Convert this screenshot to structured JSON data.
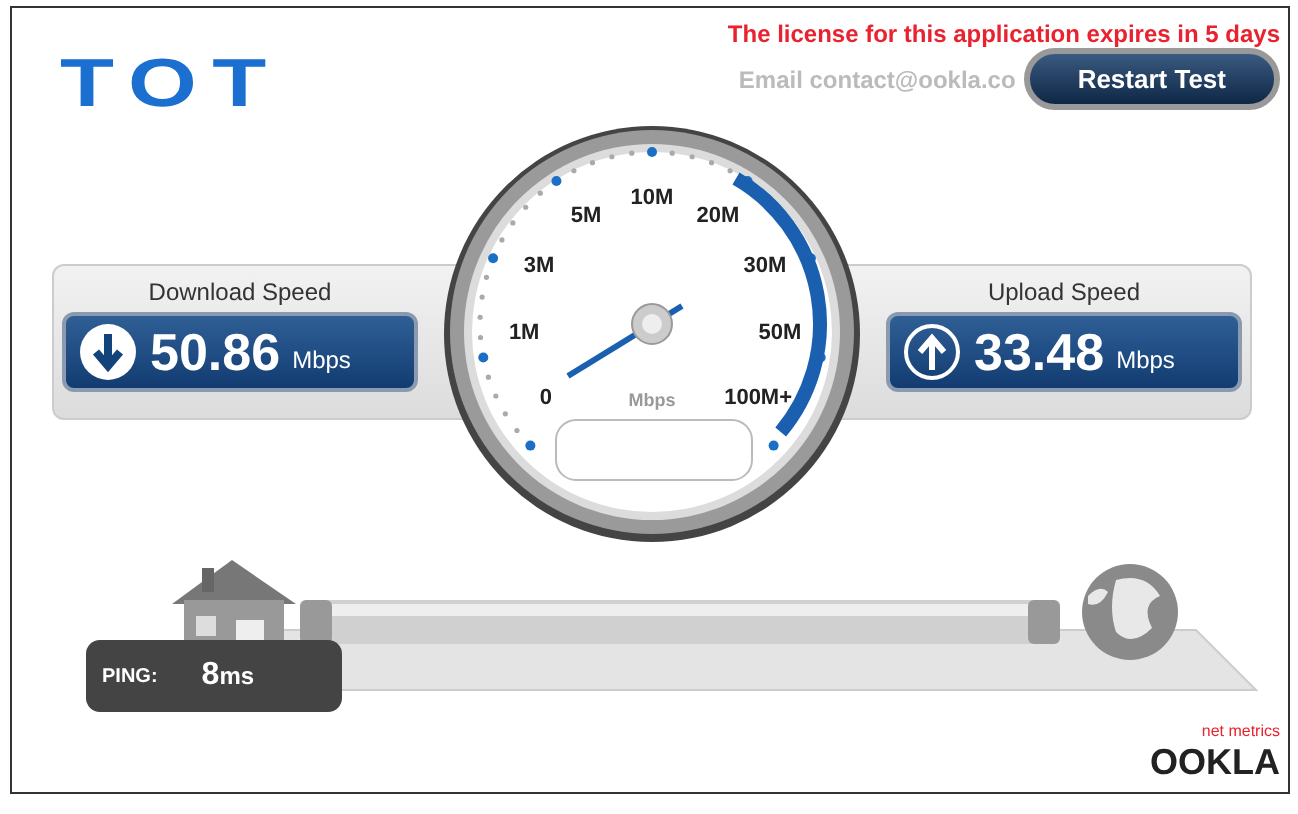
{
  "logo": {
    "text": "TOT"
  },
  "license_notice": "The license for this application expires in 5 days",
  "contact_notice": "Email contact@ookla.co",
  "restart_button": "Restart Test",
  "download": {
    "label": "Download Speed",
    "value": "50.86",
    "unit": "Mbps"
  },
  "upload": {
    "label": "Upload Speed",
    "value": "33.48",
    "unit": "Mbps"
  },
  "gauge": {
    "scale": [
      "0",
      "1M",
      "3M",
      "5M",
      "10M",
      "20M",
      "30M",
      "50M",
      "100M+"
    ],
    "unit": "Mbps"
  },
  "ping": {
    "label": "PING:",
    "value": "8",
    "unit": "ms"
  },
  "brand": {
    "tagline": "net metrics",
    "name": "OOKLA"
  }
}
